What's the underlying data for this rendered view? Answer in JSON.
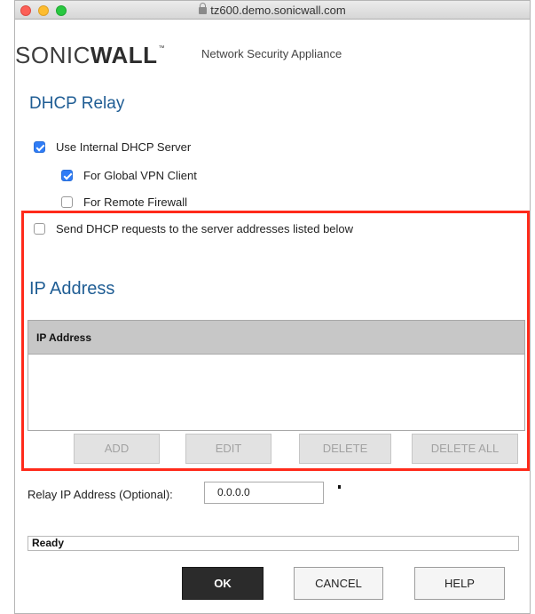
{
  "window": {
    "url": "tz600.demo.sonicwall.com"
  },
  "header": {
    "logo_text_light": "SONIC",
    "logo_text_bold": "WALL",
    "logo_tm": "™",
    "subtitle": "Network Security Appliance"
  },
  "dhcp": {
    "title": "DHCP Relay",
    "options": [
      {
        "label": "Use Internal DHCP Server",
        "checked": true
      },
      {
        "label": "For Global VPN Client",
        "checked": true
      },
      {
        "label": "For Remote Firewall",
        "checked": false
      },
      {
        "label": "Send DHCP requests to the server addresses listed below",
        "checked": false
      }
    ]
  },
  "ip_section": {
    "title": "IP Address",
    "table": {
      "columns": [
        "IP Address"
      ],
      "rows": []
    },
    "buttons": {
      "add": "ADD",
      "edit": "EDIT",
      "delete": "DELETE",
      "delete_all": "DELETE ALL"
    }
  },
  "relay": {
    "label": "Relay IP Address (Optional):",
    "value": "0.0.0.0"
  },
  "status": {
    "text": "Ready"
  },
  "footer": {
    "ok": "OK",
    "cancel": "CANCEL",
    "help": "HELP"
  },
  "colors": {
    "accent": "#1f5d94",
    "checkbox": "#2f7cf6",
    "highlight": "#ff2a1a"
  }
}
